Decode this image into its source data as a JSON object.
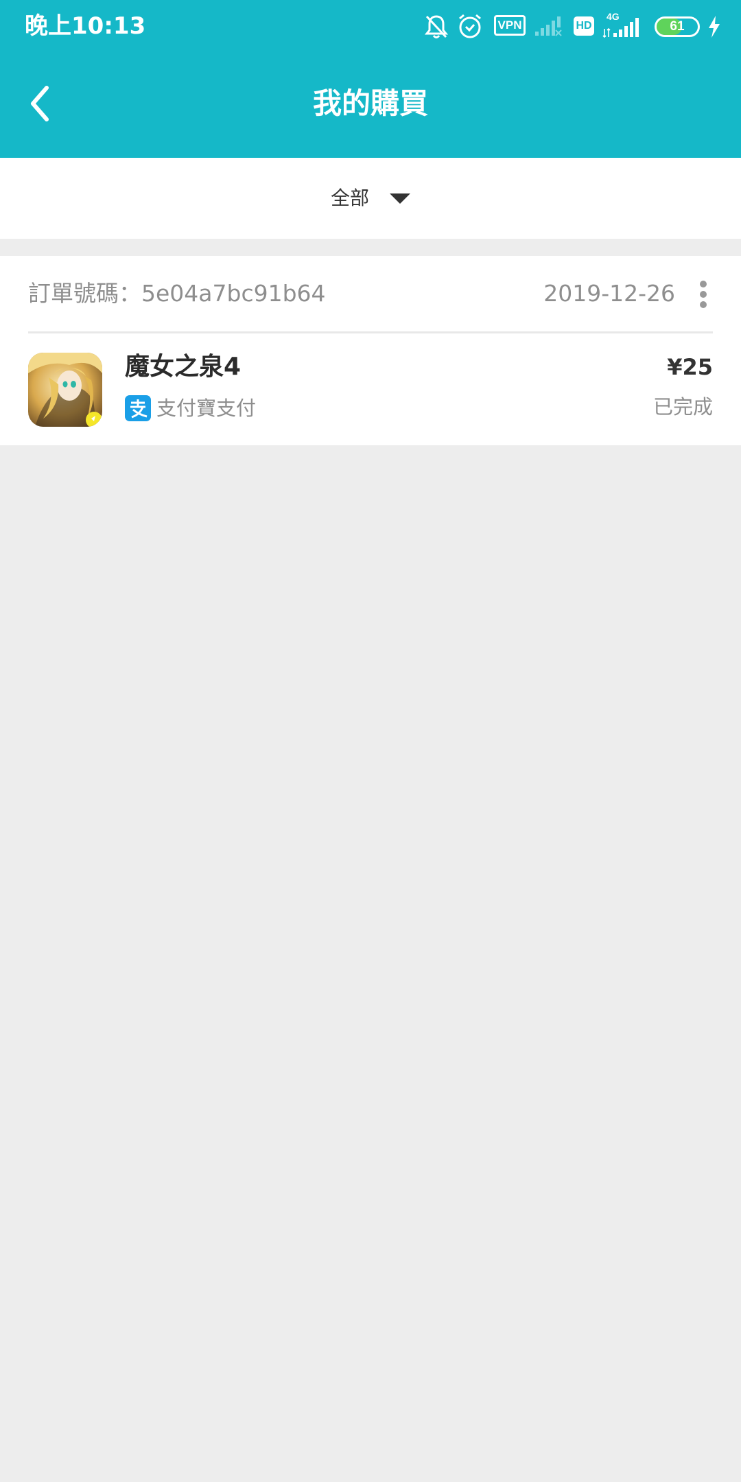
{
  "status_bar": {
    "time": "晚上10:13",
    "vpn": "VPN",
    "hd": "HD",
    "network": "4G",
    "battery": "61",
    "battery_level": 0.61,
    "icons": [
      "mute-bell-icon",
      "alarm-icon",
      "vpn-icon",
      "signal-sim2-icon",
      "hd-icon",
      "signal-4g-icon",
      "battery-icon",
      "charging-icon"
    ]
  },
  "header": {
    "title": "我的購買",
    "back_icon": "chevron-left-icon",
    "color": "#15b8c8"
  },
  "filter": {
    "label": "全部",
    "icon": "caret-down-icon"
  },
  "orders": [
    {
      "order_label": "訂單號碼：5e04a7bc91b64",
      "date": "2019-12-26",
      "menu_icon": "more-vertical-icon",
      "item": {
        "title": "魔女之泉4",
        "payment_method": "支付寶支付",
        "payment_icon": "alipay-icon",
        "price": "¥25",
        "status": "已完成"
      }
    }
  ]
}
